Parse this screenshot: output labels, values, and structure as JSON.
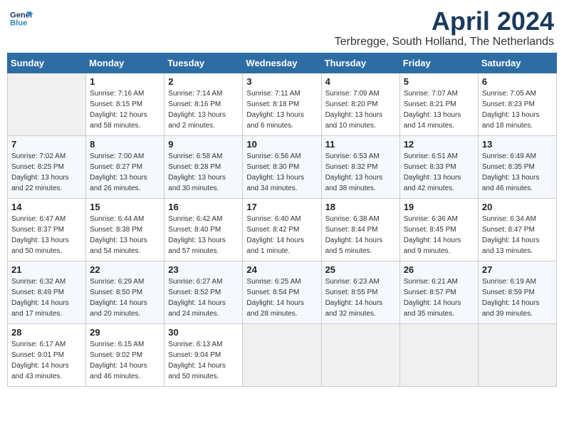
{
  "header": {
    "logo_line1": "General",
    "logo_line2": "Blue",
    "month": "April 2024",
    "location": "Terbregge, South Holland, The Netherlands"
  },
  "weekdays": [
    "Sunday",
    "Monday",
    "Tuesday",
    "Wednesday",
    "Thursday",
    "Friday",
    "Saturday"
  ],
  "weeks": [
    [
      {
        "day": "",
        "info": ""
      },
      {
        "day": "1",
        "info": "Sunrise: 7:16 AM\nSunset: 8:15 PM\nDaylight: 12 hours\nand 58 minutes."
      },
      {
        "day": "2",
        "info": "Sunrise: 7:14 AM\nSunset: 8:16 PM\nDaylight: 13 hours\nand 2 minutes."
      },
      {
        "day": "3",
        "info": "Sunrise: 7:11 AM\nSunset: 8:18 PM\nDaylight: 13 hours\nand 6 minutes."
      },
      {
        "day": "4",
        "info": "Sunrise: 7:09 AM\nSunset: 8:20 PM\nDaylight: 13 hours\nand 10 minutes."
      },
      {
        "day": "5",
        "info": "Sunrise: 7:07 AM\nSunset: 8:21 PM\nDaylight: 13 hours\nand 14 minutes."
      },
      {
        "day": "6",
        "info": "Sunrise: 7:05 AM\nSunset: 8:23 PM\nDaylight: 13 hours\nand 18 minutes."
      }
    ],
    [
      {
        "day": "7",
        "info": "Sunrise: 7:02 AM\nSunset: 8:25 PM\nDaylight: 13 hours\nand 22 minutes."
      },
      {
        "day": "8",
        "info": "Sunrise: 7:00 AM\nSunset: 8:27 PM\nDaylight: 13 hours\nand 26 minutes."
      },
      {
        "day": "9",
        "info": "Sunrise: 6:58 AM\nSunset: 8:28 PM\nDaylight: 13 hours\nand 30 minutes."
      },
      {
        "day": "10",
        "info": "Sunrise: 6:56 AM\nSunset: 8:30 PM\nDaylight: 13 hours\nand 34 minutes."
      },
      {
        "day": "11",
        "info": "Sunrise: 6:53 AM\nSunset: 8:32 PM\nDaylight: 13 hours\nand 38 minutes."
      },
      {
        "day": "12",
        "info": "Sunrise: 6:51 AM\nSunset: 8:33 PM\nDaylight: 13 hours\nand 42 minutes."
      },
      {
        "day": "13",
        "info": "Sunrise: 6:49 AM\nSunset: 8:35 PM\nDaylight: 13 hours\nand 46 minutes."
      }
    ],
    [
      {
        "day": "14",
        "info": "Sunrise: 6:47 AM\nSunset: 8:37 PM\nDaylight: 13 hours\nand 50 minutes."
      },
      {
        "day": "15",
        "info": "Sunrise: 6:44 AM\nSunset: 8:38 PM\nDaylight: 13 hours\nand 54 minutes."
      },
      {
        "day": "16",
        "info": "Sunrise: 6:42 AM\nSunset: 8:40 PM\nDaylight: 13 hours\nand 57 minutes."
      },
      {
        "day": "17",
        "info": "Sunrise: 6:40 AM\nSunset: 8:42 PM\nDaylight: 14 hours\nand 1 minute."
      },
      {
        "day": "18",
        "info": "Sunrise: 6:38 AM\nSunset: 8:44 PM\nDaylight: 14 hours\nand 5 minutes."
      },
      {
        "day": "19",
        "info": "Sunrise: 6:36 AM\nSunset: 8:45 PM\nDaylight: 14 hours\nand 9 minutes."
      },
      {
        "day": "20",
        "info": "Sunrise: 6:34 AM\nSunset: 8:47 PM\nDaylight: 14 hours\nand 13 minutes."
      }
    ],
    [
      {
        "day": "21",
        "info": "Sunrise: 6:32 AM\nSunset: 8:49 PM\nDaylight: 14 hours\nand 17 minutes."
      },
      {
        "day": "22",
        "info": "Sunrise: 6:29 AM\nSunset: 8:50 PM\nDaylight: 14 hours\nand 20 minutes."
      },
      {
        "day": "23",
        "info": "Sunrise: 6:27 AM\nSunset: 8:52 PM\nDaylight: 14 hours\nand 24 minutes."
      },
      {
        "day": "24",
        "info": "Sunrise: 6:25 AM\nSunset: 8:54 PM\nDaylight: 14 hours\nand 28 minutes."
      },
      {
        "day": "25",
        "info": "Sunrise: 6:23 AM\nSunset: 8:55 PM\nDaylight: 14 hours\nand 32 minutes."
      },
      {
        "day": "26",
        "info": "Sunrise: 6:21 AM\nSunset: 8:57 PM\nDaylight: 14 hours\nand 35 minutes."
      },
      {
        "day": "27",
        "info": "Sunrise: 6:19 AM\nSunset: 8:59 PM\nDaylight: 14 hours\nand 39 minutes."
      }
    ],
    [
      {
        "day": "28",
        "info": "Sunrise: 6:17 AM\nSunset: 9:01 PM\nDaylight: 14 hours\nand 43 minutes."
      },
      {
        "day": "29",
        "info": "Sunrise: 6:15 AM\nSunset: 9:02 PM\nDaylight: 14 hours\nand 46 minutes."
      },
      {
        "day": "30",
        "info": "Sunrise: 6:13 AM\nSunset: 9:04 PM\nDaylight: 14 hours\nand 50 minutes."
      },
      {
        "day": "",
        "info": ""
      },
      {
        "day": "",
        "info": ""
      },
      {
        "day": "",
        "info": ""
      },
      {
        "day": "",
        "info": ""
      }
    ]
  ]
}
